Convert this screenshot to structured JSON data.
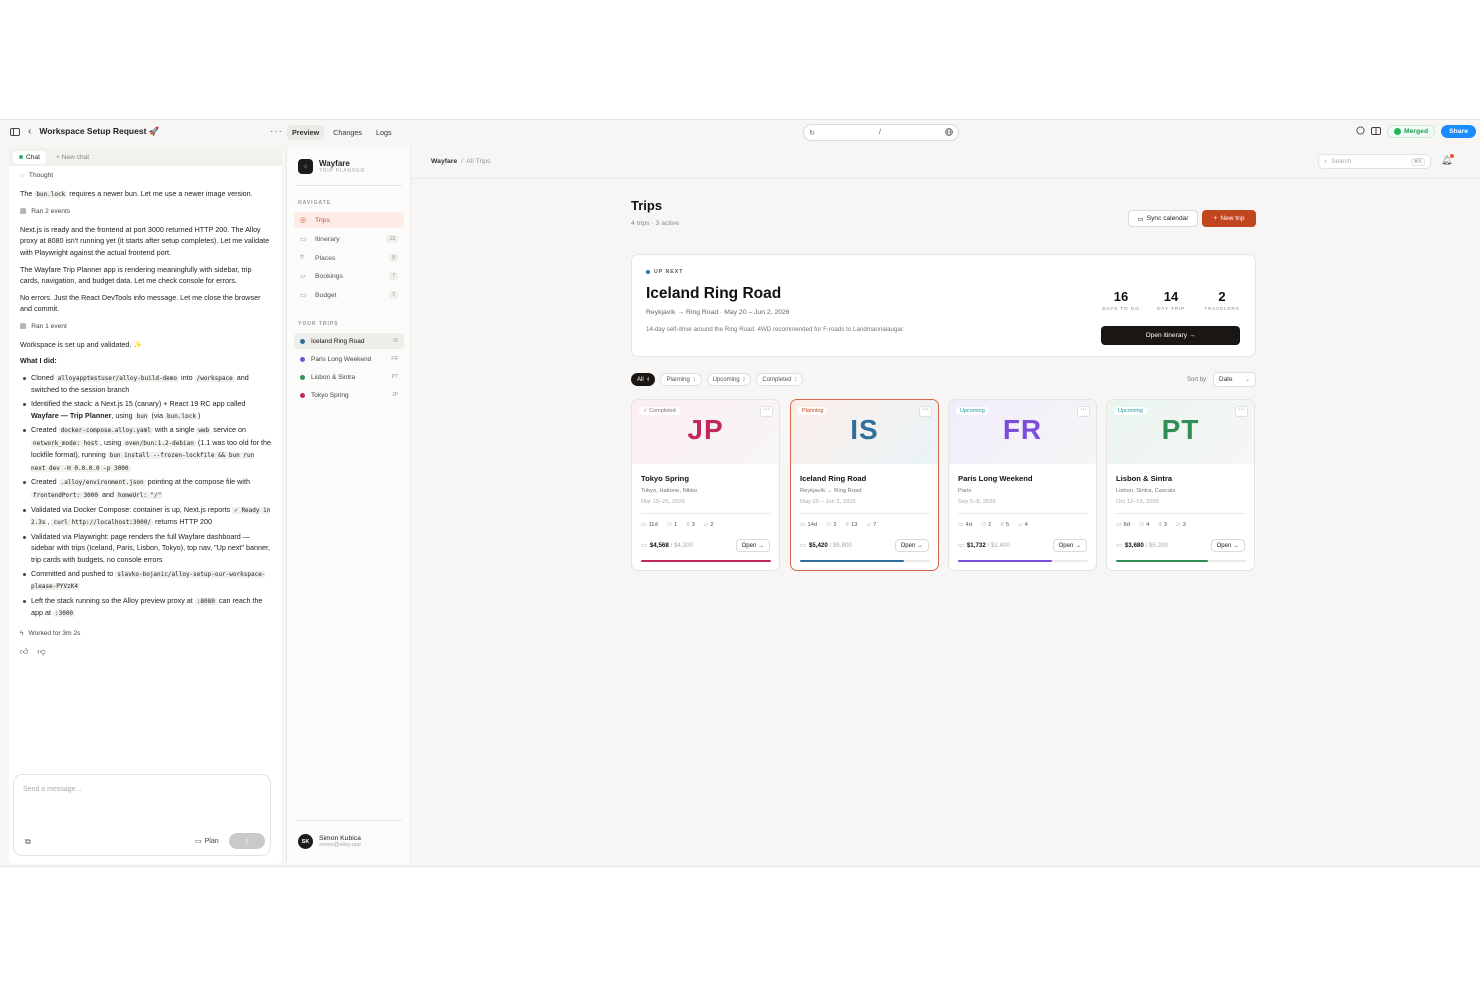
{
  "workspace": {
    "title": "Workspace Setup Request 🚀"
  },
  "tabs": [
    "Preview",
    "Changes",
    "Logs"
  ],
  "url": "/",
  "topbar": {
    "merged": "Merged",
    "share": "Share"
  },
  "chat": {
    "tab_active": "Chat",
    "tab_new": "+ New chat",
    "thought": "Thought",
    "p1_a": "The ",
    "p1_code": "bun.lock",
    "p1_b": " requires a newer bun. Let me use a newer image version.",
    "ran2": "Ran 2 events",
    "p2": "Next.js is ready and the frontend at port 3000 returned HTTP 200. The Alloy proxy at 8080 isn't running yet (it starts after setup completes). Let me validate with Playwright against the actual frontend port.",
    "p3": "The Wayfare Trip Planner app is rendering meaningfully with sidebar, trip cards, navigation, and budget data. Let me check console for errors.",
    "p4": "No errors. Just the React DevTools info message. Let me close the browser and commit.",
    "ran1": "Ran 1 event",
    "p5": "Workspace is set up and validated. ✨",
    "did_title": "What I did:",
    "worked": "Worked for 3m 2s",
    "composer_placeholder": "Send a message...",
    "plan": "Plan"
  },
  "sidebar": {
    "brand": "Wayfare",
    "brand_sub": "TRIP PLANNER",
    "navigate": "NAVIGATE",
    "nav": [
      {
        "label": "Trips",
        "count": ""
      },
      {
        "label": "Itinerary",
        "count": "13"
      },
      {
        "label": "Places",
        "count": "8"
      },
      {
        "label": "Bookings",
        "count": "7"
      },
      {
        "label": "Budget",
        "count": "7"
      }
    ],
    "your_trips": "YOUR TRIPS",
    "trips": [
      {
        "label": "Iceland Ring Road",
        "code": "IS",
        "color": "#2f6f9e"
      },
      {
        "label": "Paris Long Weekend",
        "code": "FR",
        "color": "#7c4ddb"
      },
      {
        "label": "Lisbon & Sintra",
        "code": "PT",
        "color": "#2f8f55"
      },
      {
        "label": "Tokyo Spring",
        "code": "JP",
        "color": "#c2295b"
      }
    ],
    "user_name": "Simon Kubica",
    "user_initials": "SK",
    "user_email": "simon@alloy.app"
  },
  "main": {
    "breadcrumb_root": "Wayfare",
    "breadcrumb_page": "All Trips",
    "search_placeholder": "Search",
    "search_kbd": "⌘K",
    "title": "Trips",
    "subtitle": "4 trips · 3 active",
    "sync": "Sync calendar",
    "new_trip": "New trip",
    "upnext": {
      "label": "UP NEXT",
      "title": "Iceland Ring Road",
      "route": "Reykjavík → Ring Road · May 20 – Jun 2, 2026",
      "desc": "14-day self-drive around the Ring Road. 4WD recommended for F-roads to Landmannalaugar.",
      "stats": [
        {
          "n": "16",
          "l": "DAYS TO GO"
        },
        {
          "n": "14",
          "l": "DAY TRIP"
        },
        {
          "n": "2",
          "l": "TRAVELERS"
        }
      ],
      "open": "Open itinerary →"
    },
    "filters": [
      {
        "label": "All",
        "count": "4"
      },
      {
        "label": "Planning",
        "count": "1"
      },
      {
        "label": "Upcoming",
        "count": "2"
      },
      {
        "label": "Completed",
        "count": "1"
      }
    ],
    "sort_label": "Sort by",
    "sort_value": "Date",
    "cards": [
      {
        "code": "JP",
        "status": "✓ Completed",
        "name": "Tokyo Spring",
        "places": "Tokyo, Hakone, Nikko",
        "dates": "Mar 15–25, 2026",
        "days": "11d",
        "people": "1",
        "pins": "3",
        "bookings": "2",
        "spent": "$4,568",
        "budget": "/ $4,200",
        "progress": 1.0,
        "color": "#c2295b",
        "status_color": "#777"
      },
      {
        "code": "IS",
        "status": "Planning",
        "name": "Iceland Ring Road",
        "places": "Reykjavík → Ring Road",
        "dates": "May 20 – Jun 2, 2026",
        "days": "14d",
        "people": "2",
        "pins": "13",
        "bookings": "7",
        "spent": "$5,420",
        "budget": "/ $6,800",
        "progress": 0.8,
        "color": "#2f6f9e",
        "status_color": "#c2461d"
      },
      {
        "code": "FR",
        "status": "Upcoming",
        "name": "Paris Long Weekend",
        "places": "Paris",
        "dates": "Sep 5–8, 2026",
        "days": "4d",
        "people": "2",
        "pins": "5",
        "bookings": "4",
        "spent": "$1,732",
        "budget": "/ $2,400",
        "progress": 0.72,
        "color": "#7c4ddb",
        "status_color": "#1a9aa0"
      },
      {
        "code": "PT",
        "status": "Upcoming",
        "name": "Lisbon & Sintra",
        "places": "Lisbon, Sintra, Cascais",
        "dates": "Oct 12–19, 2026",
        "days": "8d",
        "people": "4",
        "pins": "3",
        "bookings": "3",
        "spent": "$3,680",
        "budget": "/ $5,200",
        "progress": 0.71,
        "color": "#2f8f55",
        "status_color": "#1a9aa0"
      }
    ],
    "open_label": "Open →"
  }
}
